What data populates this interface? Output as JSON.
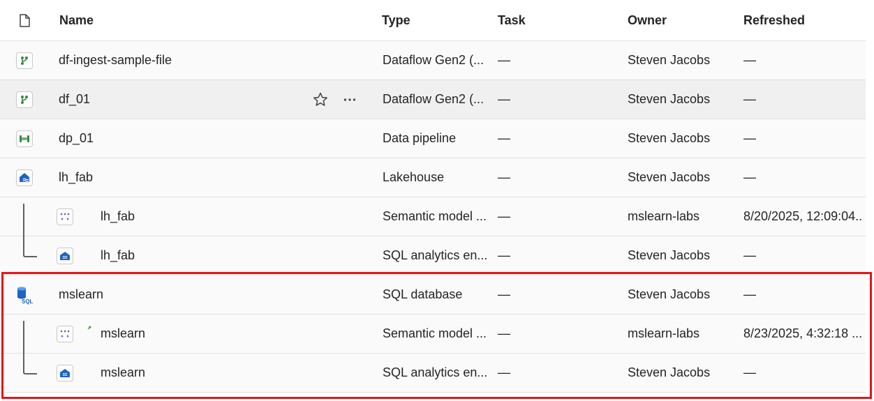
{
  "header": {
    "name": "Name",
    "type": "Type",
    "task": "Task",
    "owner": "Owner",
    "refreshed": "Refreshed"
  },
  "rows": [
    {
      "name": "df-ingest-sample-file",
      "type": "Dataflow Gen2 (...",
      "task": "—",
      "owner": "Steven Jacobs",
      "refreshed": "—",
      "icon": "dataflow-icon"
    },
    {
      "name": "df_01",
      "type": "Dataflow Gen2 (...",
      "task": "—",
      "owner": "Steven Jacobs",
      "refreshed": "—",
      "icon": "dataflow-icon"
    },
    {
      "name": "dp_01",
      "type": "Data pipeline",
      "task": "—",
      "owner": "Steven Jacobs",
      "refreshed": "—",
      "icon": "pipeline-icon"
    },
    {
      "name": "lh_fab",
      "type": "Lakehouse",
      "task": "—",
      "owner": "Steven Jacobs",
      "refreshed": "—",
      "icon": "lakehouse-icon"
    },
    {
      "name": "lh_fab",
      "type": "Semantic model ...",
      "task": "—",
      "owner": "mslearn-labs",
      "refreshed": "8/20/2025, 12:09:04...",
      "icon": "semantic-model-icon"
    },
    {
      "name": "lh_fab",
      "type": "SQL analytics en...",
      "task": "—",
      "owner": "Steven Jacobs",
      "refreshed": "—",
      "icon": "sql-endpoint-icon"
    },
    {
      "name": "mslearn",
      "type": "SQL database",
      "task": "—",
      "owner": "Steven Jacobs",
      "refreshed": "—",
      "icon": "sql-database-icon"
    },
    {
      "name": "mslearn",
      "type": "Semantic model ...",
      "task": "—",
      "owner": "mslearn-labs",
      "refreshed": "8/23/2025, 4:32:18 ...",
      "icon": "semantic-model-icon"
    },
    {
      "name": "mslearn",
      "type": "SQL analytics en...",
      "task": "—",
      "owner": "Steven Jacobs",
      "refreshed": "—",
      "icon": "sql-endpoint-icon"
    }
  ],
  "sql_icon_caption": "SQL",
  "colors": {
    "highlight": "#e3141a",
    "dataflow": "#3b8a3e",
    "lakehouse": "#1e63c4",
    "semantic": "#7a4fc9"
  }
}
